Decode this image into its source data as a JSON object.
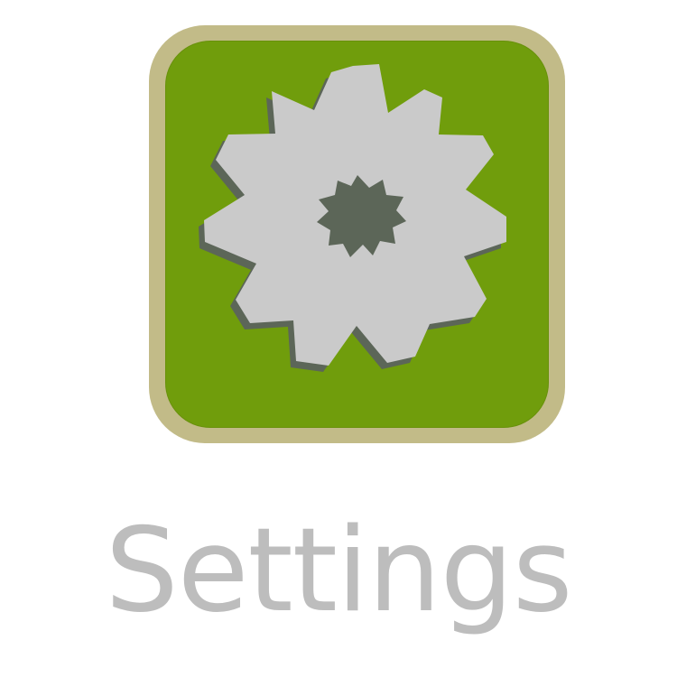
{
  "app": {
    "label": "Settings",
    "icon": "gear-icon",
    "colors": {
      "frame": "#c2bb88",
      "face": "#709d0c",
      "gear": "#cacaca",
      "gear_shadow": "#5c6658",
      "label": "#bdbdbd"
    }
  }
}
